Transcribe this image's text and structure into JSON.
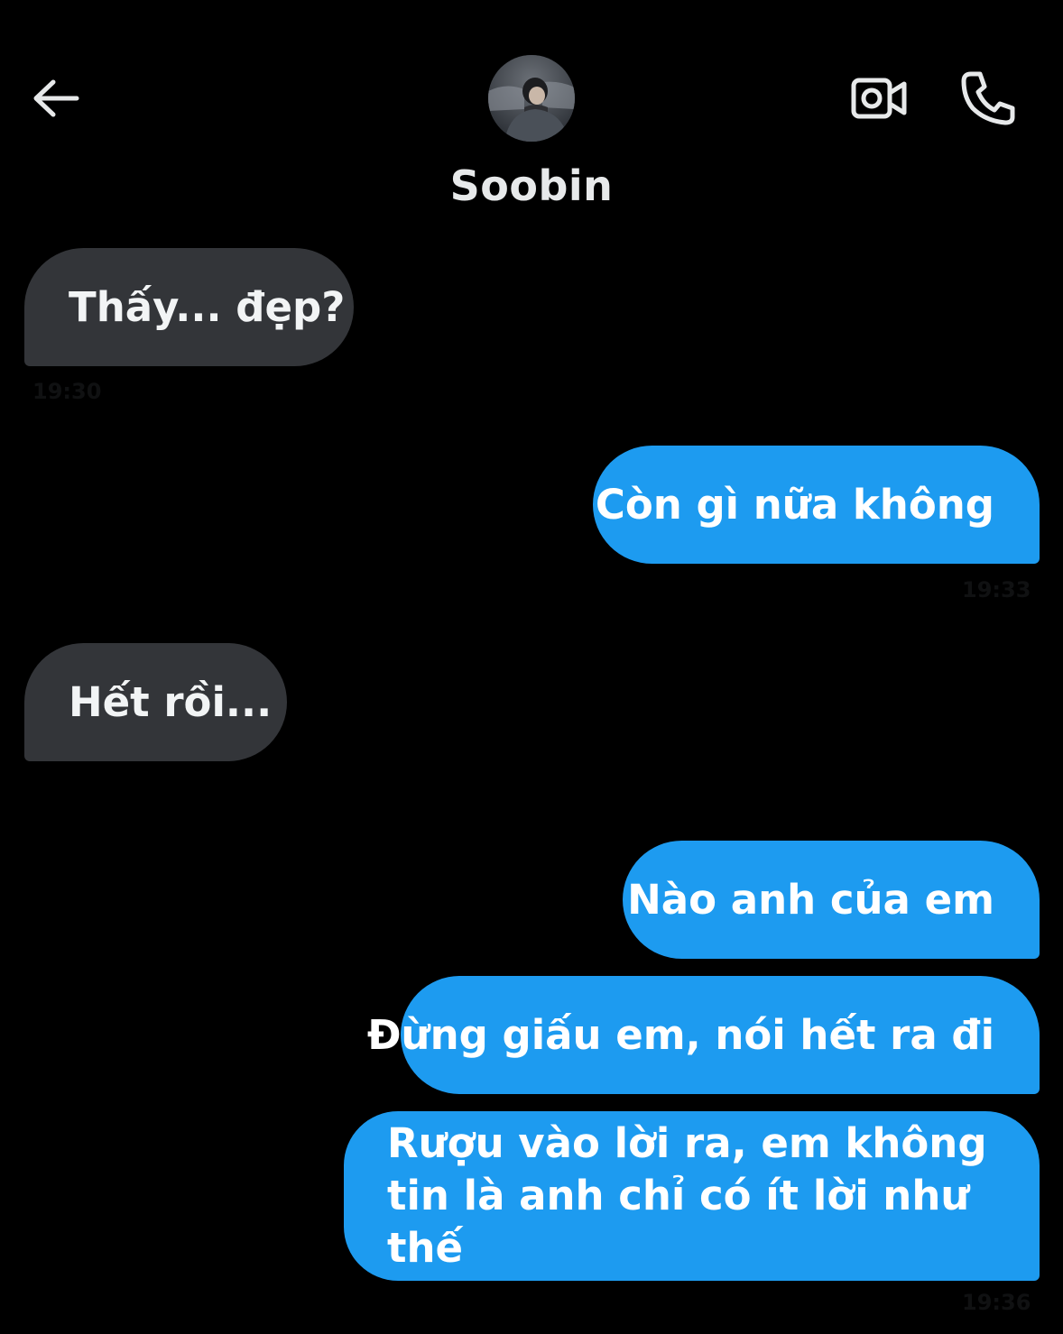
{
  "header": {
    "contact_name": "Soobin",
    "icons": {
      "back": "arrow-left-icon",
      "video": "video-camera-icon",
      "call": "phone-icon"
    }
  },
  "messages": [
    {
      "sender": "them",
      "text": "Thấy... đẹp?",
      "time": "19:30"
    },
    {
      "sender": "me",
      "text": "Còn gì nữa không",
      "time": "19:33"
    },
    {
      "sender": "them",
      "text": "Hết rồi..."
    },
    {
      "sender": "me",
      "text": "Nào anh của em"
    },
    {
      "sender": "me",
      "text": "Đừng giấu em, nói hết ra đi"
    },
    {
      "sender": "me",
      "text": "Rượu vào lời ra, em không tin là anh chỉ có ít lời như thế",
      "time": "19:36"
    }
  ],
  "colors": {
    "background": "#000000",
    "incoming_bubble": "#333539",
    "outgoing_bubble": "#1d9bf0",
    "text": "#e7e9ea"
  }
}
